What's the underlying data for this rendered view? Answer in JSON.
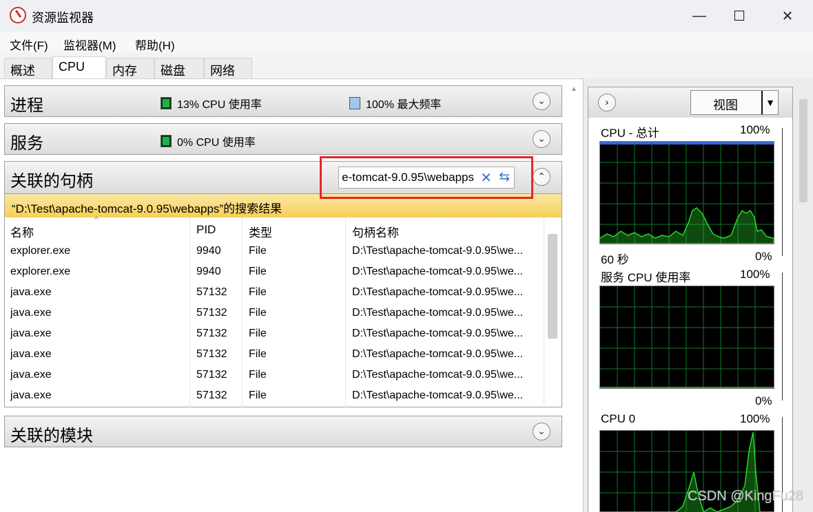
{
  "window": {
    "title": "资源监视器",
    "minimize": "—",
    "maximize": "☐",
    "close": "✕"
  },
  "menu": [
    "文件(F)",
    "监视器(M)",
    "帮助(H)"
  ],
  "tabs": [
    "概述",
    "CPU",
    "内存",
    "磁盘",
    "网络"
  ],
  "active_tab": "CPU",
  "sections": {
    "processes": {
      "title": "进程",
      "stat1": "13% CPU 使用率",
      "stat2": "100% 最大频率"
    },
    "services": {
      "title": "服务",
      "stat1": "0% CPU 使用率"
    },
    "handles": {
      "title": "关联的句柄",
      "search_value": "e-tomcat-9.0.95\\webapps"
    },
    "modules": {
      "title": "关联的模块"
    }
  },
  "search_result": "“D:\\Test\\apache-tomcat-9.0.95\\webapps”的搜索结果",
  "table": {
    "headers": [
      "名称",
      "PID",
      "类型",
      "句柄名称"
    ],
    "rows": [
      [
        "explorer.exe",
        "9940",
        "File",
        "D:\\Test\\apache-tomcat-9.0.95\\we..."
      ],
      [
        "explorer.exe",
        "9940",
        "File",
        "D:\\Test\\apache-tomcat-9.0.95\\we..."
      ],
      [
        "java.exe",
        "57132",
        "File",
        "D:\\Test\\apache-tomcat-9.0.95\\we..."
      ],
      [
        "java.exe",
        "57132",
        "File",
        "D:\\Test\\apache-tomcat-9.0.95\\we..."
      ],
      [
        "java.exe",
        "57132",
        "File",
        "D:\\Test\\apache-tomcat-9.0.95\\we..."
      ],
      [
        "java.exe",
        "57132",
        "File",
        "D:\\Test\\apache-tomcat-9.0.95\\we..."
      ],
      [
        "java.exe",
        "57132",
        "File",
        "D:\\Test\\apache-tomcat-9.0.95\\we..."
      ],
      [
        "java.exe",
        "57132",
        "File",
        "D:\\Test\\apache-tomcat-9.0.95\\we..."
      ]
    ]
  },
  "right_panel": {
    "view_button": "视图",
    "graphs": [
      {
        "title": "CPU - 总计",
        "max": "100%",
        "time": "60 秒",
        "min": "0%"
      },
      {
        "title": "服务 CPU 使用率",
        "max": "100%",
        "min": "0%"
      },
      {
        "title": "CPU 0",
        "max": "100%"
      }
    ]
  },
  "watermark": "CSDN @KingFu28",
  "colors": {
    "graph_line": "#2bd62b",
    "grid": "#0f7a2e",
    "highlight": "#e5262a",
    "banner": "#f6cf55"
  }
}
